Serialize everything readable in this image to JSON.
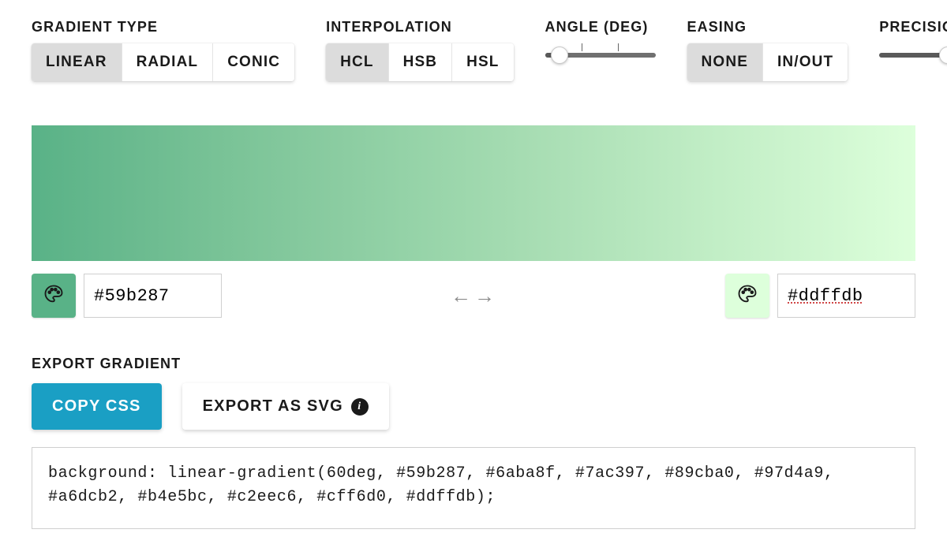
{
  "controls": {
    "gradient_type": {
      "label": "GRADIENT TYPE",
      "options": [
        "LINEAR",
        "RADIAL",
        "CONIC"
      ],
      "selected": "LINEAR"
    },
    "interpolation": {
      "label": "INTERPOLATION",
      "options": [
        "HCL",
        "HSB",
        "HSL"
      ],
      "selected": "HCL"
    },
    "angle": {
      "label": "ANGLE (DEG)",
      "min": 0,
      "max": 360,
      "value": 60,
      "percent": 13
    },
    "easing": {
      "label": "EASING",
      "options": [
        "NONE",
        "IN/OUT"
      ],
      "selected": "NONE"
    },
    "precision": {
      "label": "PRECISION",
      "min": 2,
      "max": 20,
      "value": 10,
      "percent": 62
    }
  },
  "gradient": {
    "color_start": "#59b287",
    "color_end": "#ddffdb",
    "stops": [
      "#59b287",
      "#6aba8f",
      "#7ac397",
      "#89cba0",
      "#97d4a9",
      "#a6dcb2",
      "#b4e5bc",
      "#c2eec6",
      "#cff6d0",
      "#ddffdb"
    ]
  },
  "export": {
    "label": "EXPORT GRADIENT",
    "copy_css": "COPY CSS",
    "export_svg": "EXPORT AS SVG",
    "css_output": "background: linear-gradient(60deg, #59b287, #6aba8f, #7ac397, #89cba0, #97d4a9, #a6dcb2, #b4e5bc, #c2eec6, #cff6d0, #ddffdb);"
  }
}
